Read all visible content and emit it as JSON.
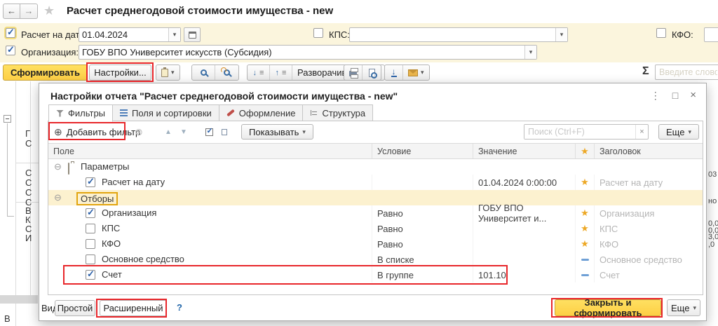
{
  "nav": {
    "title": "Расчет среднегодовой стоимости имущества - new"
  },
  "icons": {
    "back": "←",
    "forward": "→",
    "favorite": "★",
    "dropdown": "▾",
    "check": "✓",
    "sum": "Σ",
    "menu": "⋮",
    "maximize": "□",
    "close": "×",
    "add": "⊕",
    "clear_filter": "⊗",
    "move_up": "▲",
    "move_down": "▼",
    "arrow_down": "↓",
    "arrow_up": "↑",
    "bars": "≡",
    "expander": "⊖",
    "star": "★",
    "clear": "×"
  },
  "filters": {
    "date": {
      "label": "Расчет на дату:",
      "value": "01.04.2024"
    },
    "org": {
      "label": "Организация:",
      "value": "ГОБУ ВПО Университет искусств (Субсидия)"
    },
    "kps": {
      "label": "КПС:",
      "value": ""
    },
    "kfo": {
      "label": "КФО:",
      "value": ""
    }
  },
  "toolbar": {
    "generate": "Сформировать",
    "settings": "Настройки...",
    "expand_to": "Разворачивать до",
    "quick_search_placeholder": "Введите слово для"
  },
  "dialog": {
    "title": "Настройки отчета \"Расчет среднегодовой стоимости имущества - new\"",
    "tabs": [
      {
        "label": "Фильтры",
        "active": true
      },
      {
        "label": "Поля и сортировки",
        "active": false
      },
      {
        "label": "Оформление",
        "active": false
      },
      {
        "label": "Структура",
        "active": false
      }
    ],
    "toolbar": {
      "add_filter": "Добавить фильтр",
      "show": "Показывать",
      "search_placeholder": "Поиск (Ctrl+F)",
      "more": "Еще"
    },
    "table": {
      "columns": [
        "Поле",
        "Условие",
        "Значение",
        "★",
        "Заголовок"
      ],
      "rows": [
        {
          "type": "group",
          "label": "Параметры",
          "expanded": true
        },
        {
          "type": "item",
          "checked": true,
          "field": "Расчет на дату",
          "condition": "",
          "value": "01.04.2024 0:00:00",
          "flag": "star",
          "header": "Расчет на дату"
        },
        {
          "type": "group",
          "label": "Отборы",
          "expanded": true,
          "selected": true
        },
        {
          "type": "item",
          "checked": true,
          "field": "Организация",
          "condition": "Равно",
          "value": "ГОБУ ВПО Университет и...",
          "flag": "star",
          "header": "Организация"
        },
        {
          "type": "item",
          "checked": false,
          "field": "КПС",
          "condition": "Равно",
          "value": "",
          "flag": "star",
          "header": "КПС"
        },
        {
          "type": "item",
          "checked": false,
          "field": "КФО",
          "condition": "Равно",
          "value": "",
          "flag": "star",
          "header": "КФО"
        },
        {
          "type": "item",
          "checked": false,
          "field": "Основное средство",
          "condition": "В списке",
          "value": "",
          "flag": "dash",
          "header": "Основное средство"
        },
        {
          "type": "item",
          "checked": true,
          "field": "Счет",
          "condition": "В группе",
          "value": "101.10",
          "flag": "dash",
          "header": "Счет"
        }
      ]
    },
    "footer": {
      "view_label": "Вид:",
      "simple": "Простой",
      "extended": "Расширенный",
      "help": "?",
      "close_generate": "Закрыть и сформировать",
      "more": "Еще"
    }
  },
  "background": {
    "left": [
      "Г",
      "С",
      "С",
      "С",
      "С",
      "С",
      "В",
      "К",
      "С",
      "И",
      "В"
    ],
    "right": [
      "03",
      "но",
      "0,0",
      "0,0",
      "3,0",
      ",0"
    ]
  }
}
